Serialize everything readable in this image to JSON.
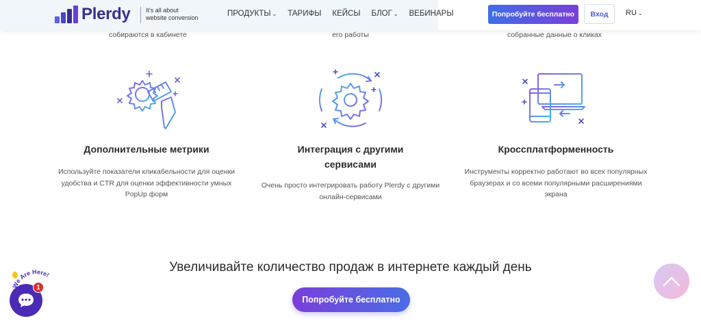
{
  "header": {
    "logo_text": "Plerdy",
    "tagline_line1": "It's all about",
    "tagline_line2": "website conversion",
    "nav": [
      {
        "label": "ПРОДУКТЫ",
        "has_dropdown": true
      },
      {
        "label": "ТАРИФЫ",
        "has_dropdown": false
      },
      {
        "label": "КЕЙСЫ",
        "has_dropdown": false
      },
      {
        "label": "БЛОГ",
        "has_dropdown": true
      },
      {
        "label": "ВЕБИНАРЫ",
        "has_dropdown": false
      }
    ],
    "cta_label": "Попробуйте бесплатно",
    "login_label": "Вход",
    "lang_label": "RU"
  },
  "top_captions": [
    "собираются в кабинете",
    "его работы",
    "собранные данные о кликах"
  ],
  "features": [
    {
      "icon": "gear-ruler-pencil-icon",
      "title": "Дополнительные метрики",
      "desc": [
        "Используйте показатели кликабельности для оценки",
        "удобства и CTR для оценки эффективности умных",
        "PopUp форм"
      ]
    },
    {
      "icon": "gear-sync-icon",
      "title_line1": "Интеграция с другими",
      "title_line2": "сервисами",
      "desc": [
        "Очень просто интегрировать работу Plerdy с другими",
        "онлайн-сервисами"
      ]
    },
    {
      "icon": "devices-icon",
      "title": "Кроссплатформенность",
      "desc": [
        "Инструменты корректно работают во всех популярных",
        "браузерах и со всеми популярными расширениями",
        "экрана"
      ]
    }
  ],
  "slogan": "Увеличивайте количество продаж в интернете каждый день",
  "bottom_cta_label": "Попробуйте бесплатно",
  "chat": {
    "badge_count": "1",
    "label": "We Are Here!"
  },
  "colors": {
    "brand": "#3a2f8f",
    "accent_blue": "#3f6ee8",
    "accent_purple": "#7a3fd9",
    "chat": "#4b2bb5",
    "badge": "#e02b2b"
  }
}
